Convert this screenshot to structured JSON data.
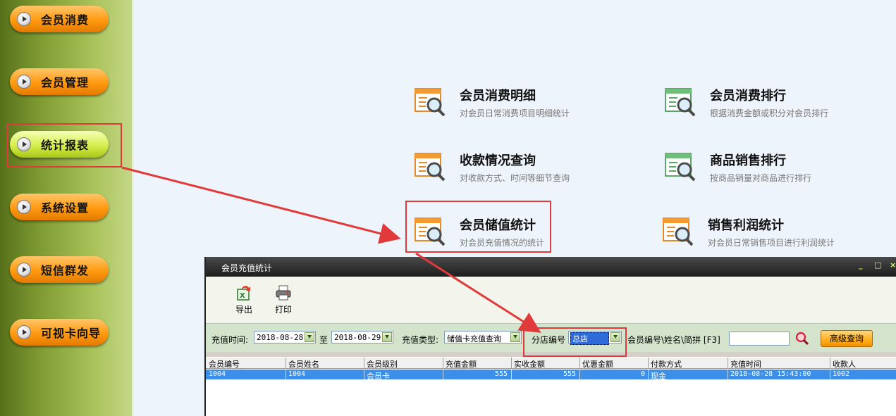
{
  "nav": {
    "items": [
      {
        "label": "会员消费"
      },
      {
        "label": "会员管理"
      },
      {
        "label": "统计报表"
      },
      {
        "label": "系统设置"
      },
      {
        "label": "短信群发"
      },
      {
        "label": "可视卡向导"
      }
    ],
    "active_index": 2
  },
  "reports": [
    {
      "title": "会员消费明细",
      "desc": "对会员日常消费项目明细统计",
      "icon": "orange-report-magnifier-icon"
    },
    {
      "title": "会员消费排行",
      "desc": "根据消费金额或积分对会员排行",
      "icon": "green-report-magnifier-icon"
    },
    {
      "title": "收款情况查询",
      "desc": "对收款方式、时间等细节查询",
      "icon": "orange-report-magnifier-icon"
    },
    {
      "title": "商品销售排行",
      "desc": "按商品销量对商品进行排行",
      "icon": "green-report-magnifier-icon"
    },
    {
      "title": "会员储值统计",
      "desc": "对会员充值情况的统计",
      "icon": "orange-report-magnifier-icon"
    },
    {
      "title": "销售利润统计",
      "desc": "对会员日常销售项目进行利润统计",
      "icon": "orange-report-magnifier-icon"
    }
  ],
  "dialog": {
    "title": "会员充值统计",
    "window_buttons": {
      "minimize": "_",
      "maximize": "□",
      "close": "×"
    },
    "toolbar": {
      "export_label": "导出",
      "print_label": "打印"
    },
    "filters": {
      "time_label": "充值时间:",
      "date_from": "2018-08-28",
      "to_label": "至",
      "date_to": "2018-08-29",
      "type_label": "充值类型:",
      "type_value": "储值卡充值查询",
      "branch_label": "分店编号",
      "branch_value": "总店",
      "search_label": "会员编号\\姓名\\简拼 [F3]",
      "search_value": "",
      "advanced_label": "高级查询"
    },
    "table": {
      "columns": [
        "会员编号",
        "会员姓名",
        "会员级别",
        "充值金额",
        "实收金额",
        "优惠金额",
        "付款方式",
        "充值时间",
        "收款人"
      ],
      "rows": [
        [
          "1004",
          "1004",
          "会员卡",
          "555",
          "555",
          "0",
          "现金",
          "2018-08-28 15:43:00",
          "1002"
        ]
      ]
    }
  },
  "colors": {
    "highlight_box": "#e03a3a",
    "selected_row": "#3d8ee8",
    "nav_button": "#ff9a10",
    "nav_button_active": "#d6ee4c"
  }
}
